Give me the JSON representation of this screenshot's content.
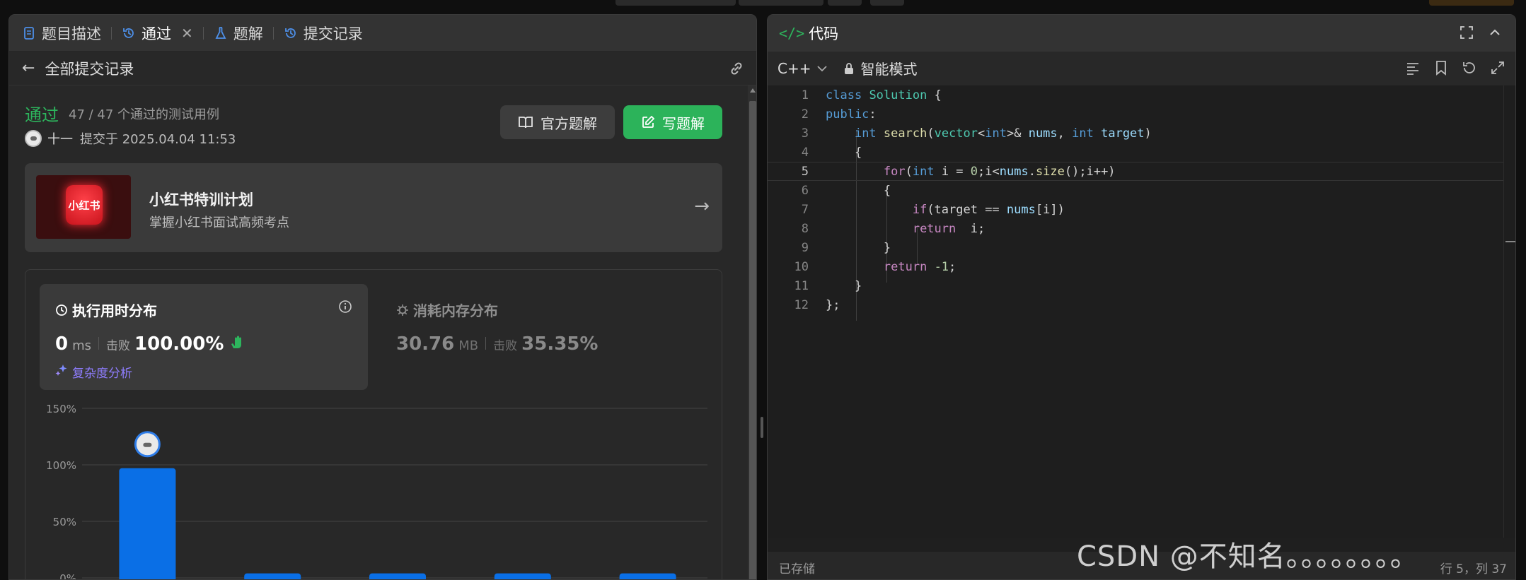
{
  "left_panel": {
    "tabs": [
      {
        "label": "题目描述",
        "icon": "document-icon"
      },
      {
        "label": "通过",
        "icon": "history-icon",
        "active": true,
        "closable": true
      },
      {
        "label": "题解",
        "icon": "flask-icon"
      },
      {
        "label": "提交记录",
        "icon": "history-icon"
      }
    ],
    "close_glyph": "✕",
    "back_glyph": "←",
    "subheader_title": "全部提交记录",
    "result": {
      "status": "通过",
      "testcases": "47 / 47 个通过的测试用例",
      "user": "十一",
      "submitted_at": "提交于 2025.04.04 11:53"
    },
    "buttons": {
      "official_solution": "官方题解",
      "write_solution": "写题解"
    },
    "promo": {
      "logo_text": "小红书",
      "title": "小红书特训计划",
      "subtitle": "掌握小红书面试高频考点",
      "arrow": "→"
    },
    "runtime": {
      "title": "执行用时分布",
      "value": "0",
      "unit": "ms",
      "beat_label": "击败",
      "beat_pct": "100.00%",
      "complexity_link": "复杂度分析"
    },
    "memory": {
      "title": "消耗内存分布",
      "value": "30.76",
      "unit": "MB",
      "beat_label": "击败",
      "beat_pct": "35.35%"
    }
  },
  "chart_data": {
    "type": "bar",
    "categories": [
      "",
      "",
      "",
      "",
      ""
    ],
    "values": [
      97,
      4,
      4,
      4,
      4
    ],
    "ytick_labels": [
      "150%",
      "100%",
      "50%",
      "0%"
    ],
    "yticks": [
      150,
      100,
      50,
      0
    ],
    "ylim": [
      0,
      150
    ],
    "bar_color": "#0a6fe6",
    "grid": true,
    "marker_on_bar": 0
  },
  "right_panel": {
    "title": "代码",
    "code_icon": "</>",
    "language": "C++",
    "mode": "智能模式",
    "status": "已存储",
    "cursor": "行 5，列 37",
    "code_lines": [
      "class Solution {",
      "public:",
      "    int search(vector<int>& nums, int target)",
      "    {",
      "        for(int i = 0;i<nums.size();i++)",
      "        {",
      "            if(target == nums[i])",
      "            return  i;",
      "        }",
      "        return -1;",
      "    }",
      "};"
    ],
    "current_line": 5
  },
  "watermark": "CSDN @不知名。。。。。。。。",
  "colors": {
    "accent_green": "#2db55d",
    "bar_blue": "#0a6fe6",
    "complexity_purple": "#8f7dff"
  }
}
